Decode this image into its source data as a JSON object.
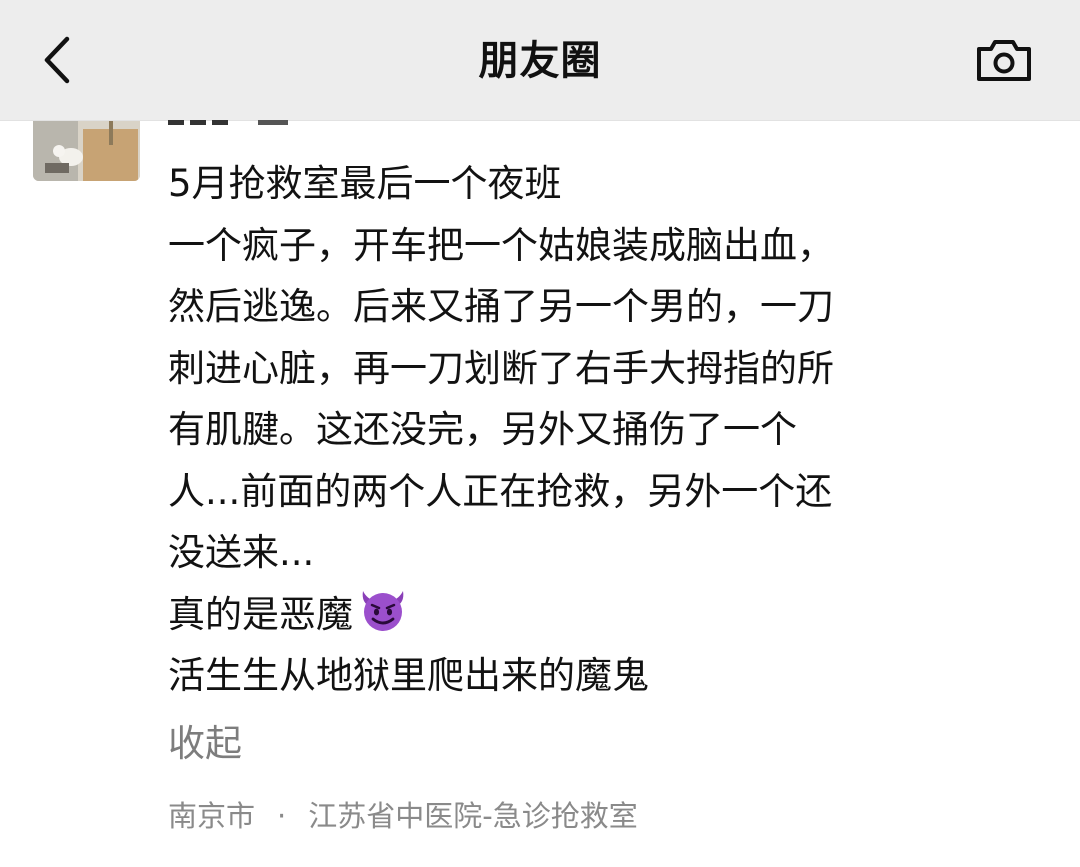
{
  "navbar": {
    "title": "朋友圈",
    "back_icon": "chevron-left-icon",
    "camera_icon": "camera-icon"
  },
  "post": {
    "lines": [
      "5月抢救室最后一个夜班",
      "一个疯子，开车把一个姑娘装成脑出血，",
      "然后逃逸。后来又捅了另一个男的，一刀",
      "刺进心脏，再一刀划断了右手大拇指的所",
      "有肌腱。这还没完，另外又捅伤了一个",
      "人...前面的两个人正在抢救，另外一个还",
      "没送来...",
      "真的是恶魔",
      "活生生从地狱里爬出来的魔鬼"
    ],
    "emoji": "smiling-imp-emoji",
    "collapse_label": "收起",
    "location_city": "南京市",
    "location_separator": "·",
    "location_place": "江苏省中医院-急诊抢救室"
  },
  "colors": {
    "navbar_bg": "#ededed",
    "text": "#121212",
    "secondary_text": "#7d7d7d",
    "emoji_purple": "#8a3fb8"
  }
}
